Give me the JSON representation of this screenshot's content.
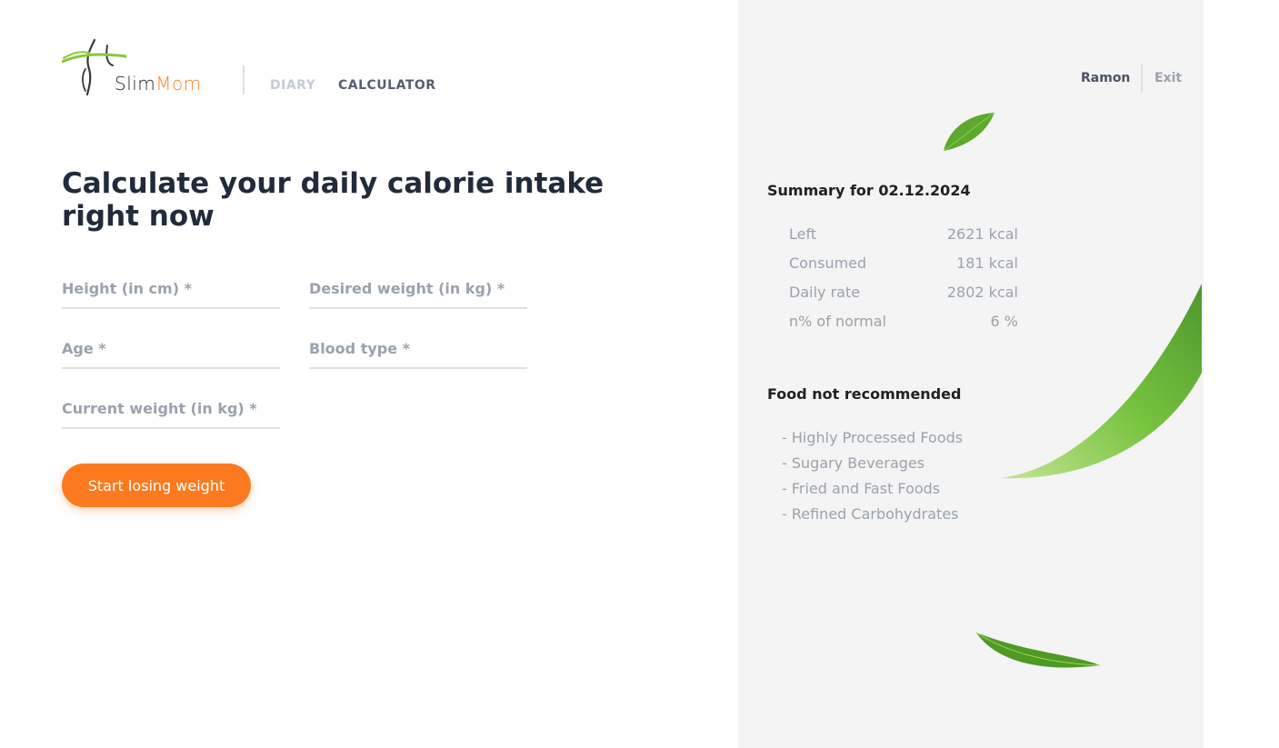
{
  "header": {
    "logo": {
      "slim": "Slim",
      "mom": "Mom"
    },
    "nav": {
      "diary": "DIARY",
      "calculator": "CALCULATOR"
    },
    "user": {
      "name": "Ramon",
      "exit": "Exit"
    }
  },
  "calculator": {
    "title": "Calculate your daily calorie intake right now",
    "fields": {
      "height": {
        "placeholder": "Height (in cm) *",
        "value": ""
      },
      "desired_weight": {
        "placeholder": "Desired weight (in kg) *",
        "value": ""
      },
      "age": {
        "placeholder": "Age *",
        "value": ""
      },
      "blood_type": {
        "placeholder": "Blood type *",
        "value": ""
      },
      "current_weight": {
        "placeholder": "Current weight (in kg) *",
        "value": ""
      }
    },
    "submit_label": "Start losing weight"
  },
  "summary": {
    "title": "Summary for 02.12.2024",
    "rows": [
      {
        "label": "Left",
        "value": "2621 kcal"
      },
      {
        "label": "Consumed",
        "value": "181 kcal"
      },
      {
        "label": "Daily rate",
        "value": "2802 kcal"
      },
      {
        "label": "n% of normal",
        "value": "6 %"
      }
    ]
  },
  "food": {
    "title": "Food not recommended",
    "items": [
      "- Highly Processed Foods",
      "- Sugary Beverages",
      "- Fried and Fast Foods",
      "- Refined Carbohydrates"
    ]
  },
  "colors": {
    "accent": "#fc842d",
    "panel_bg": "#f4f4f4",
    "muted_text": "#9aa2ad",
    "dark_text": "#212121",
    "leaf_green": "#5aa82a"
  }
}
